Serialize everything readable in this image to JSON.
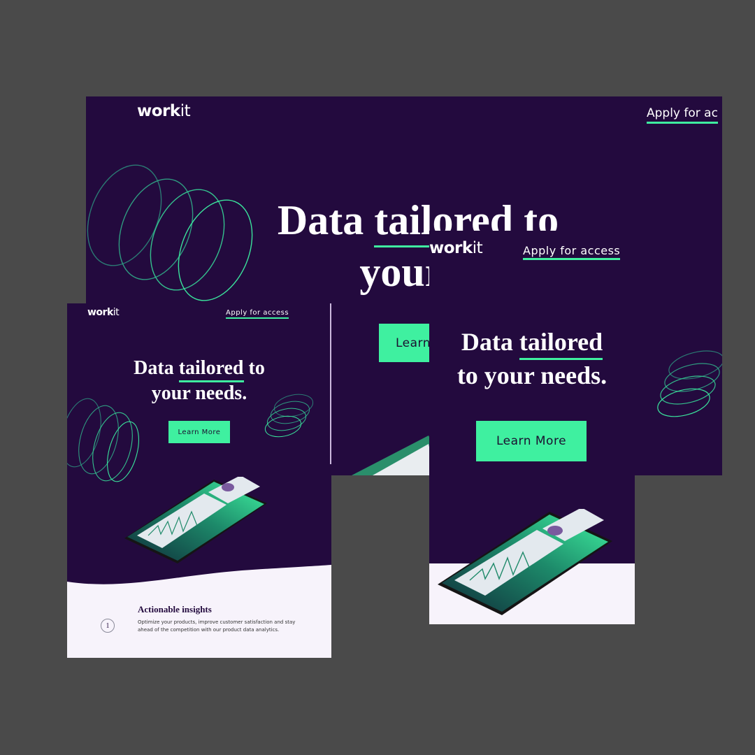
{
  "brand": {
    "logo_strong": "work",
    "logo_light": "it"
  },
  "nav": {
    "apply_label": "Apply for access",
    "apply_label_cropped": "Apply for ac"
  },
  "hero": {
    "tailored": "tailored",
    "desktop_line1_pre": "Data ",
    "desktop_line1_post": " to",
    "desktop_line2": "your n",
    "tablet_line1_pre": "Data ",
    "tablet_line1_post": " to",
    "tablet_line2": "your needs.",
    "mobile_line1_pre": "Data ",
    "mobile_line2": "to your needs.",
    "cta_label": "Learn More",
    "cta_cropped": "Learn"
  },
  "feature": {
    "number": "1",
    "title": "Actionable insights",
    "body": "Optimize your products, improve customer satisfaction and stay ahead of the competition with our product data analytics."
  },
  "colors": {
    "bg": "#230a3e",
    "accent": "#3ff0a0",
    "light": "#f7f3fb",
    "backdrop": "#4a4a4a"
  }
}
